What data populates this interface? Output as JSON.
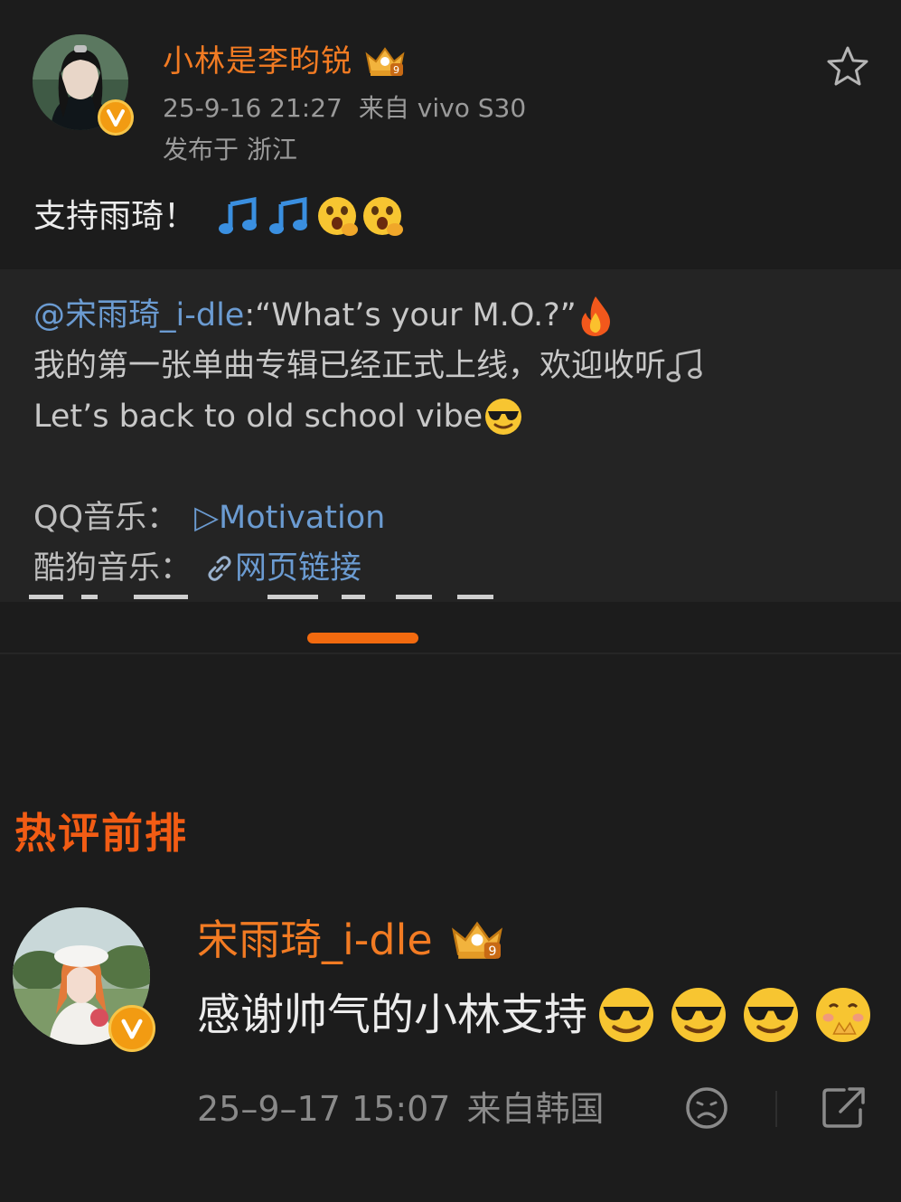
{
  "post": {
    "author": "小林是李昀锐",
    "timestamp": "25-9-16 21:27",
    "source": "来自 vivo S30",
    "location": "发布于 浙江",
    "text": "支持雨琦！"
  },
  "repost": {
    "mention": "@宋雨琦_i-dle",
    "line1_text": ":“What’s your M.O.?”",
    "line2_text": "我的第一张单曲专辑已经正式上线，欢迎收听",
    "line3_text": "Let’s back to old school vibe",
    "qq_label": "QQ音乐：",
    "qq_link": "▷Motivation",
    "kugou_label": "酷狗音乐：",
    "kugou_link": "网页链接"
  },
  "hot_comments": {
    "title": "热评前排",
    "items": [
      {
        "author": "宋雨琦_i-dle",
        "text": "感谢帅气的小林支持",
        "timestamp": "25–9–17 15:07",
        "source": "来自韩国"
      }
    ]
  },
  "icons": [
    "star-icon",
    "crown-icon",
    "verified-icon",
    "music-note-icon",
    "fire-icon",
    "sunglasses-emoji-icon",
    "link-icon",
    "dislike-face-icon",
    "share-icon"
  ],
  "colors": {
    "background": "#1c1c1c",
    "repost_background": "#242424",
    "accent_orange": "#f27b23",
    "link_blue": "#6b9bd1",
    "hot_title": "#f25c14",
    "tab_indicator": "#f26a0f"
  }
}
